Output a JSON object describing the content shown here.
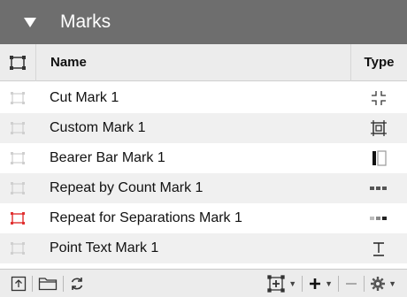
{
  "panel": {
    "title": "Marks"
  },
  "columns": {
    "name": "Name",
    "type": "Type"
  },
  "rows": [
    {
      "name": "Cut Mark 1",
      "type_icon": "cut-mark-icon",
      "selected_icon_color": "#cfcfcf"
    },
    {
      "name": "Custom Mark 1",
      "type_icon": "custom-mark-icon",
      "selected_icon_color": "#cfcfcf"
    },
    {
      "name": "Bearer Bar Mark 1",
      "type_icon": "bearer-bar-icon",
      "selected_icon_color": "#cfcfcf"
    },
    {
      "name": "Repeat by Count Mark 1",
      "type_icon": "repeat-count-icon",
      "selected_icon_color": "#cfcfcf"
    },
    {
      "name": "Repeat for Separations Mark 1",
      "type_icon": "repeat-separations-icon",
      "selected_icon_color": "#e03030"
    },
    {
      "name": "Point Text Mark 1",
      "type_icon": "point-text-icon",
      "selected_icon_color": "#cfcfcf"
    }
  ],
  "colors": {
    "header_bg": "#6e6e6e",
    "accent_red": "#e03030"
  }
}
